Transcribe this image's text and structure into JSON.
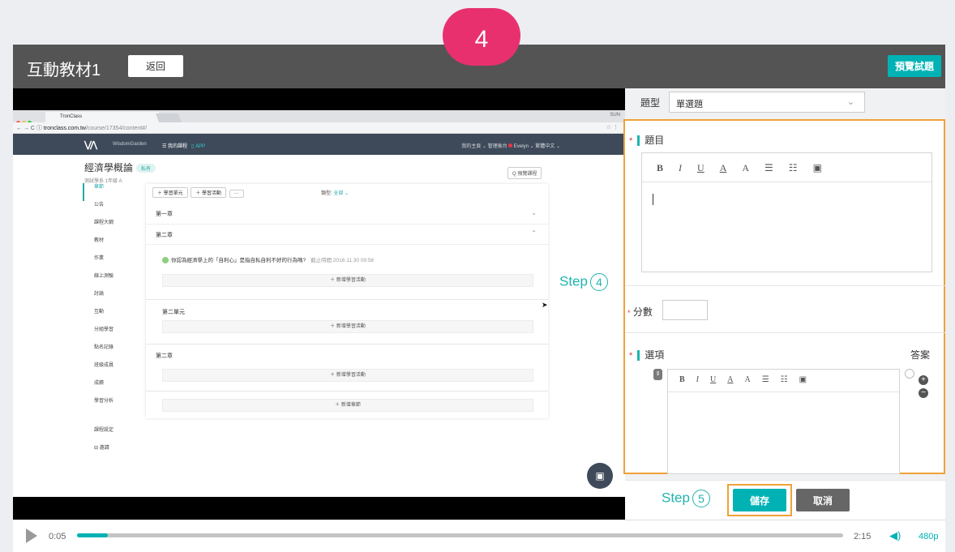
{
  "app": {
    "title": "互動教材1",
    "back_label": "返回",
    "preview_label": "預覽試題",
    "step_badge": "4"
  },
  "browser": {
    "tab_title": "TronClass",
    "tab_right": "SUN",
    "url_host": "tronclass.com.tw",
    "url_path": "/course/17354/content#/",
    "brand": "WisdomGarden",
    "nav_courses": "☰ 我的課程",
    "nav_app": "▯ APP",
    "nav_right": "我的主頁 ⌄   管理後台",
    "user": "Evelyn ⌄   繁體中文 ⌄"
  },
  "course": {
    "title": "經濟學概論",
    "badge": "私有",
    "subtitle": "測試學系 1年級 A",
    "preview_course": "Q 預覽課程",
    "sidebar": [
      "章節",
      "公告",
      "課程大綱",
      "教材",
      "作業",
      "線上測驗",
      "討論",
      "互動",
      "分組學習",
      "點名記錄",
      "班級成員",
      "成績",
      "學習分析",
      "課程設定",
      "⊟ 邀請"
    ],
    "toolbar_add_unit": "＋ 學習單元",
    "toolbar_add_activity": "＋ 學習活動",
    "toolbar_more": "···",
    "filter_label": "類型:",
    "filter_value": "全部 ⌄",
    "chapter1": "第一章",
    "chapter2": "第二章",
    "activity_title": "你認為經濟學上的「自利心」是指自私自利不好的行為嗎?",
    "activity_due": "截止時間  2016.11.30 09:58",
    "add_activity": "＋ 新增學習活動",
    "unit2": "第二單元",
    "chapter2b": "第二章",
    "add_chapter": "＋ 新增章節"
  },
  "form": {
    "type_label": "題型",
    "type_value": "單選題",
    "question_label": "題目",
    "score_label": "分數",
    "options_label": "選項",
    "answer_label": "答案",
    "required_mark": "*",
    "toolbar": [
      "B",
      "I",
      "U",
      "A",
      "A",
      "☰",
      "☷",
      "▣"
    ],
    "save_label": "儲存",
    "cancel_label": "取消"
  },
  "steps": {
    "step4_text": "Step",
    "step4_num": "4",
    "step5_text": "Step",
    "step5_num": "5"
  },
  "player": {
    "current_time": "0:05",
    "duration": "2:15",
    "quality": "480p",
    "progress": 0.04
  }
}
